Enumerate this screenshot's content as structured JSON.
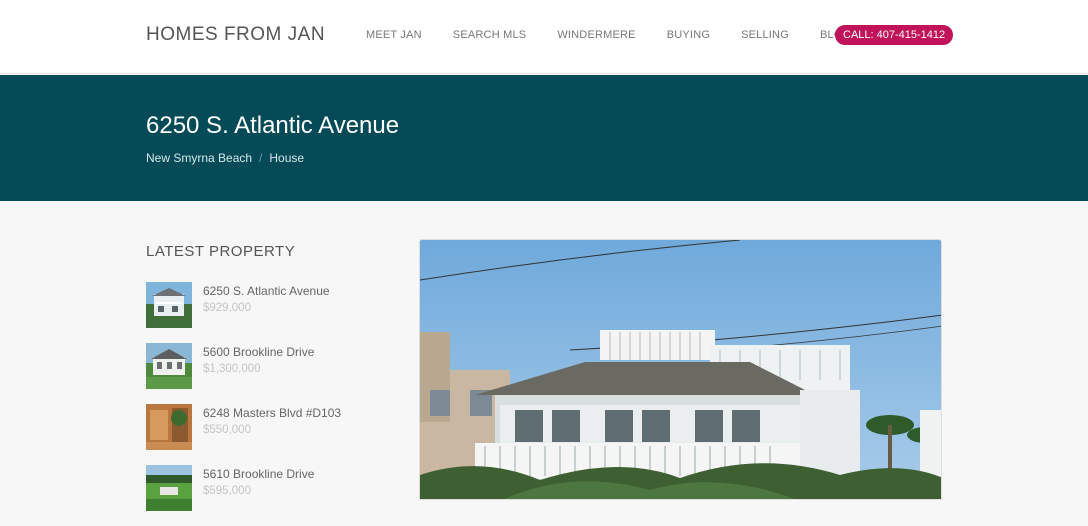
{
  "header": {
    "brand": "HOMES FROM JAN",
    "nav": [
      "MEET JAN",
      "SEARCH MLS",
      "WINDERMERE",
      "BUYING",
      "SELLING",
      "BLOG"
    ],
    "call": "CALL: 407-415-1412"
  },
  "hero": {
    "title": "6250 S. Atlantic Avenue",
    "breadcrumb": [
      "New Smyrna Beach",
      "House"
    ],
    "separator": "/"
  },
  "sidebar": {
    "title": "LATEST PROPERTY",
    "items": [
      {
        "name": "6250 S. Atlantic Avenue",
        "price": "$929,000"
      },
      {
        "name": "5600 Brookline Drive",
        "price": "$1,300,000"
      },
      {
        "name": "6248 Masters Blvd #D103",
        "price": "$550,000"
      },
      {
        "name": "5610 Brookline Drive",
        "price": "$595,000"
      }
    ]
  },
  "colors": {
    "hero_bg": "#054a57",
    "accent": "#c0135a"
  }
}
